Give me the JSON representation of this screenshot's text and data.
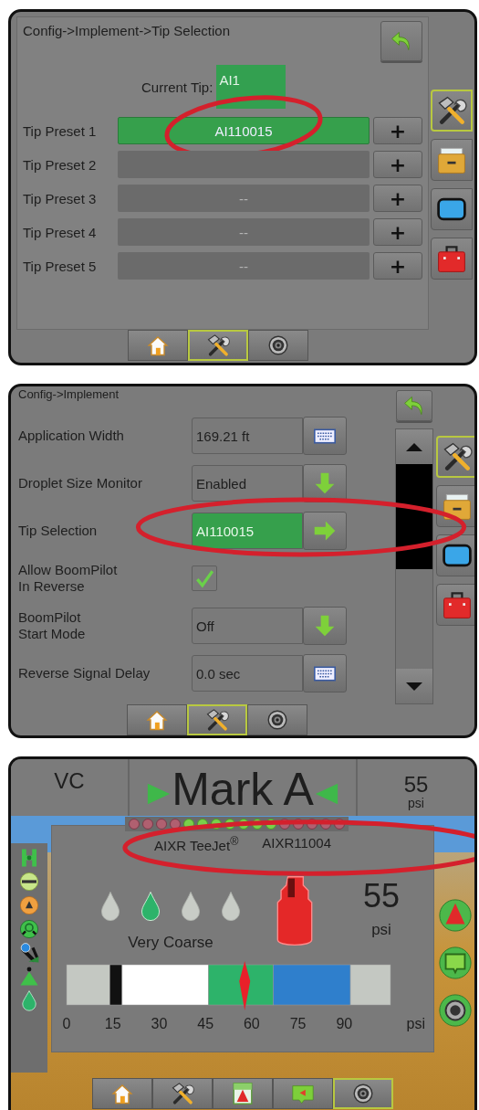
{
  "tip_selection_screen": {
    "breadcrumb": "Config->Implement->Tip Selection",
    "current_tip": {
      "label": "Current Tip:",
      "value": "AI1"
    },
    "presets": [
      {
        "label": "Tip Preset 1",
        "value": "AI110015",
        "selected": true,
        "highlighted": true,
        "add": "+"
      },
      {
        "label": "Tip Preset 2",
        "selected": false,
        "highlighted": false,
        "add": "+"
      },
      {
        "label": "Tip Preset 3",
        "value": "--",
        "selected": false,
        "highlighted": false,
        "add": "+"
      },
      {
        "label": "Tip Preset 4",
        "value": "--",
        "selected": false,
        "highlighted": false,
        "add": "+"
      },
      {
        "label": "Tip Preset 5",
        "value": "--",
        "selected": false,
        "highlighted": false,
        "add": "+"
      }
    ],
    "side_tabs": [
      {
        "kind": "tools",
        "selected": true
      },
      {
        "kind": "console",
        "selected": false
      },
      {
        "kind": "display",
        "selected": false
      },
      {
        "kind": "toolbox",
        "selected": false
      }
    ],
    "bottom_tabs": [
      {
        "kind": "home",
        "selected": false
      },
      {
        "kind": "tools",
        "selected": true
      },
      {
        "kind": "camera",
        "selected": false
      }
    ]
  },
  "implement_screen": {
    "breadcrumb": "Config->Implement",
    "settings": [
      {
        "kind": "keyboard",
        "label": "Application Width",
        "value": "169.21 ft",
        "highlighted": false
      },
      {
        "kind": "dropdown",
        "label": "Droplet Size Monitor",
        "value": "Enabled",
        "highlighted": false
      },
      {
        "kind": "link",
        "label": "Tip Selection",
        "value": "AI110015",
        "highlighted": true
      },
      {
        "kind": "checkbox",
        "label": "Allow BoomPilot\nIn Reverse",
        "checked": true,
        "highlighted": false
      },
      {
        "kind": "dropdown",
        "label": "BoomPilot\nStart Mode",
        "value": "Off",
        "highlighted": false
      },
      {
        "kind": "keyboard",
        "label": "Reverse Signal Delay",
        "value": "0.0 sec",
        "highlighted": false
      }
    ],
    "side_tabs": [
      {
        "kind": "tools",
        "selected": true
      },
      {
        "kind": "console",
        "selected": false
      },
      {
        "kind": "display",
        "selected": false
      },
      {
        "kind": "toolbox",
        "selected": false
      }
    ],
    "bottom_tabs": [
      {
        "kind": "home",
        "selected": false
      },
      {
        "kind": "tools",
        "selected": true
      },
      {
        "kind": "camera",
        "selected": false
      }
    ]
  },
  "run_screen": {
    "header": {
      "left": "VC",
      "center": "Mark A",
      "right_value": "55",
      "right_unit": "psi"
    },
    "sections": [
      {
        "on": false
      },
      {
        "on": false
      },
      {
        "on": false
      },
      {
        "on": false
      },
      {
        "on": true
      },
      {
        "on": true
      },
      {
        "on": true
      },
      {
        "on": true
      },
      {
        "on": true
      },
      {
        "on": true
      },
      {
        "on": true
      },
      {
        "on": false
      },
      {
        "on": false
      },
      {
        "on": false
      },
      {
        "on": false
      },
      {
        "on": false
      }
    ],
    "nozzle": {
      "brand": "AIXR TeeJet$^{®}$",
      "model": "AIXR11004",
      "highlighted": true
    },
    "droplets": [
      {
        "selected": false
      },
      {
        "selected": true
      },
      {
        "selected": false
      },
      {
        "selected": false
      }
    ],
    "droplet_label": "Very Coarse",
    "pressure": {
      "value": "55",
      "unit": "psi"
    },
    "pressure_gauge": {
      "needle": {
        "level": 0.55
      },
      "chart_data": {
        "type": "bar",
        "orientation": "horizontal",
        "stacked": true,
        "xlabel": "psi",
        "xlim": [
          0,
          105
        ],
        "xticks": [
          0,
          15,
          30,
          45,
          60,
          75,
          90
        ],
        "series": [
          {
            "color": "#c4c8c2",
            "values": [
              14
            ]
          },
          {
            "color": "#111111",
            "values": [
              4
            ]
          },
          {
            "color": "#ffffff",
            "values": [
              28
            ]
          },
          {
            "color": "#2db36a",
            "values": [
              21
            ]
          },
          {
            "color": "#2f7fcc",
            "values": [
              25
            ]
          },
          {
            "color": "#c4c8c2",
            "values": [
              13
            ]
          }
        ]
      }
    },
    "left_tools": [
      {
        "kind": "boom"
      },
      {
        "kind": "bar"
      },
      {
        "kind": "master"
      },
      {
        "kind": "valve"
      },
      {
        "kind": "tilt"
      },
      {
        "kind": "guidance"
      },
      {
        "kind": "drop"
      }
    ],
    "right_buttons": [
      {
        "kind": "guidance"
      },
      {
        "kind": "map"
      },
      {
        "kind": "camera"
      }
    ],
    "bottom_tabs": [
      {
        "kind": "home",
        "selected": false
      },
      {
        "kind": "tools",
        "selected": false
      },
      {
        "kind": "guidance",
        "selected": false
      },
      {
        "kind": "map",
        "selected": false
      },
      {
        "kind": "camera",
        "selected": true
      }
    ]
  }
}
